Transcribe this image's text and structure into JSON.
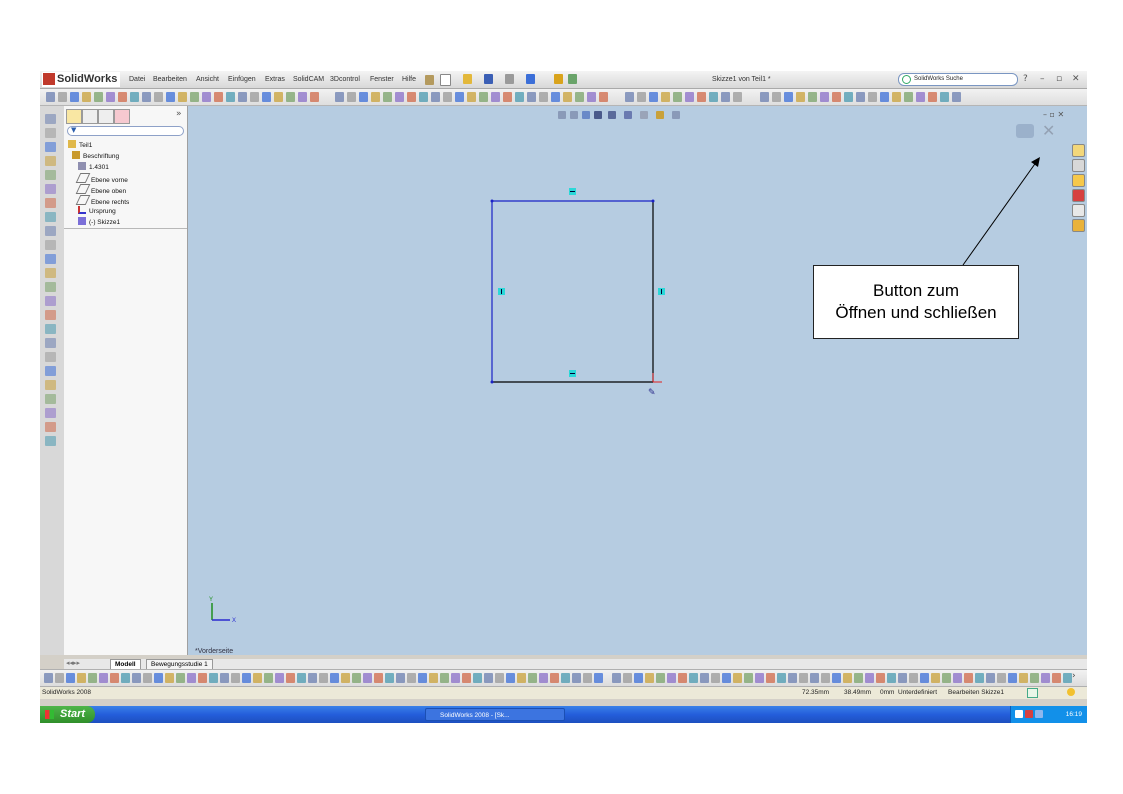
{
  "app": {
    "logo_text": "SolidWorks",
    "document_title": "Skizze1 von Teil1 *",
    "search_placeholder": "SolidWorks Suche",
    "help_label": "?",
    "menu": [
      "Datei",
      "Bearbeiten",
      "Ansicht",
      "Einfügen",
      "Extras",
      "SolidCAM",
      "3Dcontrol",
      "Fenster",
      "Hilfe"
    ]
  },
  "feature_tree": {
    "items": [
      {
        "label": "Teil1",
        "icon": "part-icon"
      },
      {
        "label": "Beschriftung",
        "icon": "annotation-icon"
      },
      {
        "label": "1.4301",
        "icon": "material-icon"
      },
      {
        "label": "Ebene vorne",
        "icon": "plane-icon"
      },
      {
        "label": "Ebene oben",
        "icon": "plane-icon"
      },
      {
        "label": "Ebene rechts",
        "icon": "plane-icon"
      },
      {
        "label": "Ursprung",
        "icon": "origin-icon"
      },
      {
        "label": "(-) Skizze1",
        "icon": "sketch-icon"
      }
    ]
  },
  "graphics": {
    "view_label": "*Vorderseite",
    "annotation_text_line1": "Button zum",
    "annotation_text_line2": "Öffnen und schließen",
    "axis_x": "X",
    "axis_y": "Y"
  },
  "tabs": {
    "model": "Modell",
    "motion": "Bewegungsstudie 1"
  },
  "status": {
    "app_version": "SolidWorks 2008",
    "x_coord": "72.35mm",
    "y_coord": "38.49mm",
    "z_coord": "0mm",
    "definition": "Unterdefiniert",
    "mode": "Bearbeiten Skizze1"
  },
  "taskbar": {
    "start_label": "Start",
    "task_item": "SolidWorks 2008 - [Sk...",
    "clock": "16:19"
  },
  "colors": {
    "viewport": "#b6cce1",
    "sketch_line_blue": "#1b22c6",
    "sketch_line_black": "#000000",
    "taskbar_blue": "#245edb",
    "start_green": "#3c9f36"
  }
}
